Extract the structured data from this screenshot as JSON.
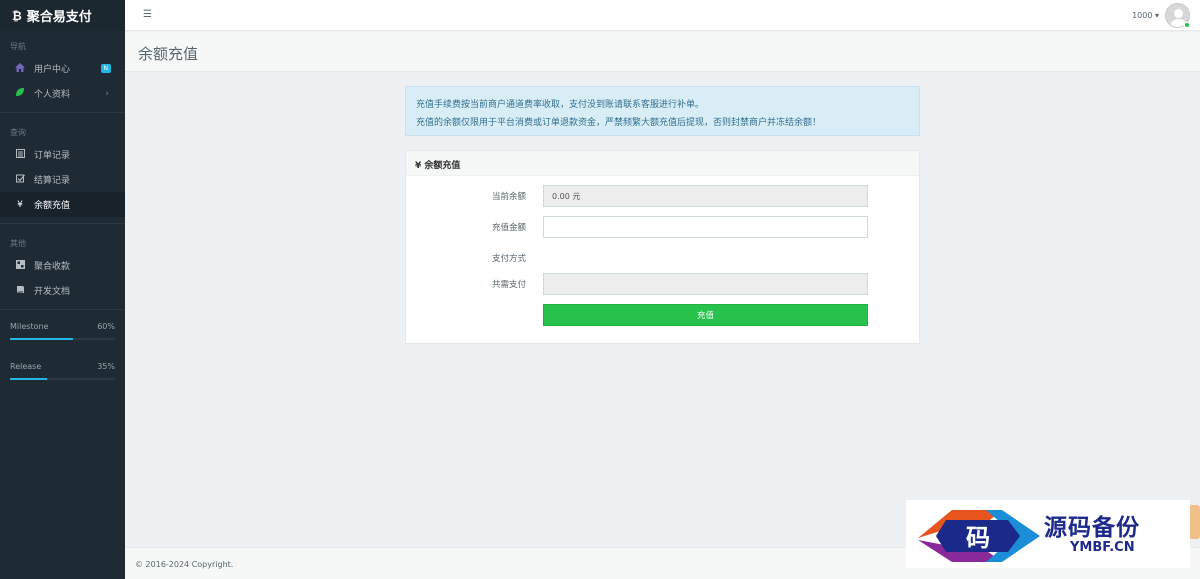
{
  "brand": {
    "logo_icon": "bitcoin-icon",
    "name": "聚合易支付"
  },
  "sidebar": {
    "sections": [
      {
        "title": "导航",
        "items": [
          {
            "icon": "home-icon",
            "label": "用户中心",
            "badge": "N"
          },
          {
            "icon": "leaf-icon",
            "label": "个人资料"
          }
        ]
      },
      {
        "title": "查询",
        "items": [
          {
            "icon": "list-icon",
            "label": "订单记录"
          },
          {
            "icon": "checkbox-icon",
            "label": "结算记录"
          },
          {
            "icon": "yen-icon",
            "label": "余额充值"
          }
        ]
      },
      {
        "title": "其他",
        "items": [
          {
            "icon": "qrcode-icon",
            "label": "聚合收款"
          },
          {
            "icon": "book-icon",
            "label": "开发文档"
          }
        ]
      }
    ],
    "progress": [
      {
        "label": "Milestone",
        "value": "60%"
      },
      {
        "label": "Release",
        "value": "35%"
      }
    ]
  },
  "header": {
    "user": "1000",
    "menu_icon": "hamburger-icon"
  },
  "page": {
    "title": "余额充值"
  },
  "notice": {
    "line1": "充值手续费按当前商户通道费率收取，支付没到账请联系客服进行补单。",
    "line2": "充值的余额仅限用于平台消费或订单退款资金，严禁频繁大额充值后提现，否则封禁商户并冻结余额！"
  },
  "panel": {
    "heading": "¥ 余额充值",
    "fields": {
      "balance_label": "当前余额",
      "balance_value": "0.00 元",
      "amount_label": "充值金额",
      "amount_value": "",
      "method_label": "支付方式",
      "total_label": "共需支付",
      "total_value": ""
    },
    "submit": "充值"
  },
  "footer": {
    "copyright": "© 2016-2024 Copyright."
  },
  "watermark": {
    "mark_char": "码",
    "title": "源码备份",
    "subtitle": "YMBF.CN"
  },
  "colors": {
    "sidebar": "#1e2b34",
    "accent": "#23b7e5",
    "success": "#27c24c",
    "notice_bg": "#d9edf7"
  }
}
